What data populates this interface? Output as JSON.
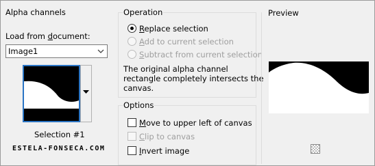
{
  "alpha_channels": {
    "title": "Alpha channels",
    "load_label_pre": "Load from ",
    "load_label_key": "d",
    "load_label_post": "ocument:",
    "document_value": "Image1",
    "thumbnail_caption": "Selection #1",
    "watermark": "ESTELA-FONSECA.COM"
  },
  "operation": {
    "title": "Operation",
    "options": [
      {
        "key": "R",
        "rest": "eplace selection",
        "selected": true,
        "enabled": true
      },
      {
        "key": "A",
        "rest": "dd to current selection",
        "selected": false,
        "enabled": false
      },
      {
        "key": "S",
        "rest": "ubtract from current selection",
        "selected": false,
        "enabled": false
      }
    ],
    "message": [
      "The original alpha channel",
      "rectangle completely intersects the",
      "canvas."
    ]
  },
  "options": {
    "title": "Options",
    "items": [
      {
        "key": "M",
        "rest": "ove to upper left of canvas",
        "checked": false,
        "enabled": true
      },
      {
        "key": "C",
        "rest": "lip to canvas",
        "checked": false,
        "enabled": false
      },
      {
        "key": "I",
        "rest": "nvert image",
        "checked": false,
        "enabled": true
      }
    ]
  },
  "preview": {
    "title": "Preview"
  },
  "icons": {
    "dropdown": "chevron-down-icon",
    "thumb_menu": "triangle-down-icon",
    "transparency": "checkerboard-icon"
  },
  "colors": {
    "selection_border": "#2a74c4",
    "background": "#f0f0f0"
  }
}
